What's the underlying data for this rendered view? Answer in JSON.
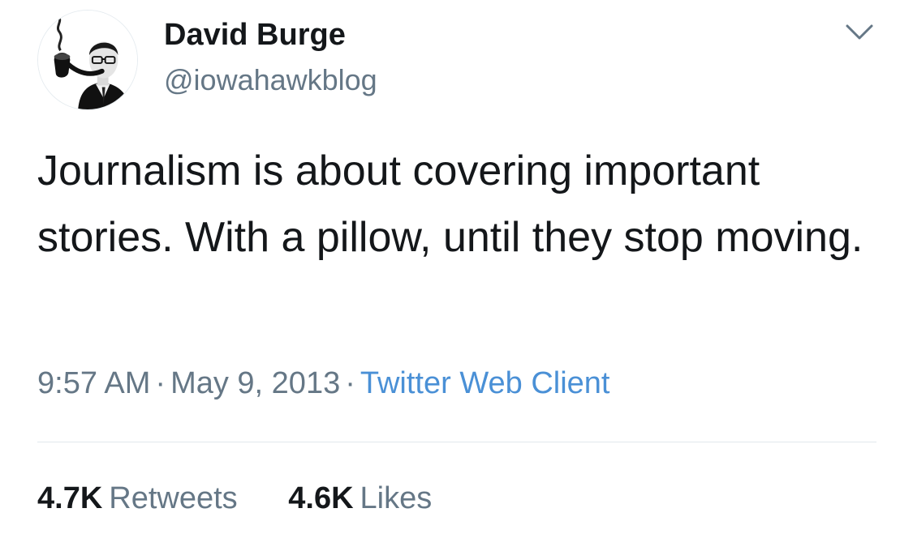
{
  "author": {
    "display_name": "David Burge",
    "handle": "@iowahawkblog",
    "avatar_icon": "avatar-photo"
  },
  "menu": {
    "icon": "chevron-down-icon"
  },
  "tweet": {
    "text": "Journalism is about covering important stories. With a pillow, until they stop moving."
  },
  "meta": {
    "time": "9:57 AM",
    "separator": "·",
    "date": "May 9, 2013",
    "source": "Twitter Web Client"
  },
  "stats": {
    "retweets_count": "4.7K",
    "retweets_label": "Retweets",
    "likes_count": "4.6K",
    "likes_label": "Likes"
  },
  "colors": {
    "text": "#14171a",
    "secondary": "#657786",
    "link": "#4a90d6",
    "divider": "#e1e8ed"
  }
}
